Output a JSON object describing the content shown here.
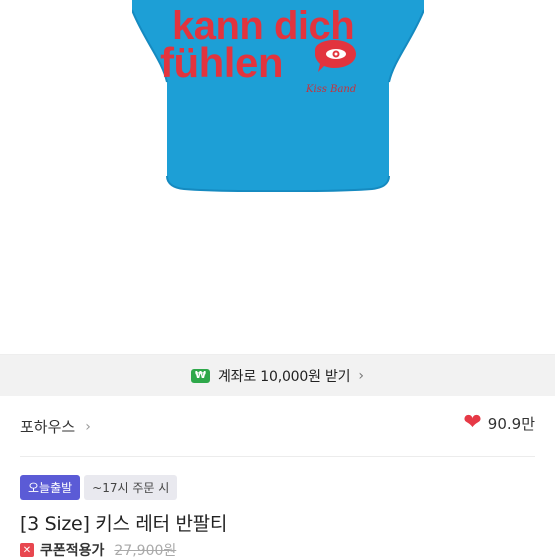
{
  "product_image": {
    "print_line1": "kann dich",
    "print_line2": "fühlen",
    "signature": "Kiss Band",
    "shirt_color": "#1d9fd6",
    "print_color": "#e2343e"
  },
  "banner": {
    "icon": "won-icon",
    "icon_glyph": "₩",
    "text": "계좌로 10,000원 받기",
    "chevron": "›"
  },
  "shop": {
    "name": "포하우스",
    "chevron": "›",
    "likes": "90.9만",
    "heart_glyph": "❤"
  },
  "tags": {
    "primary": "오늘출발",
    "secondary": "~17시 주문 시"
  },
  "product": {
    "title": "[3 Size] 키스 레터 반팔티"
  },
  "price": {
    "coupon_glyph": "✕",
    "coupon_label": "쿠폰적용가",
    "original": "27,900원"
  }
}
